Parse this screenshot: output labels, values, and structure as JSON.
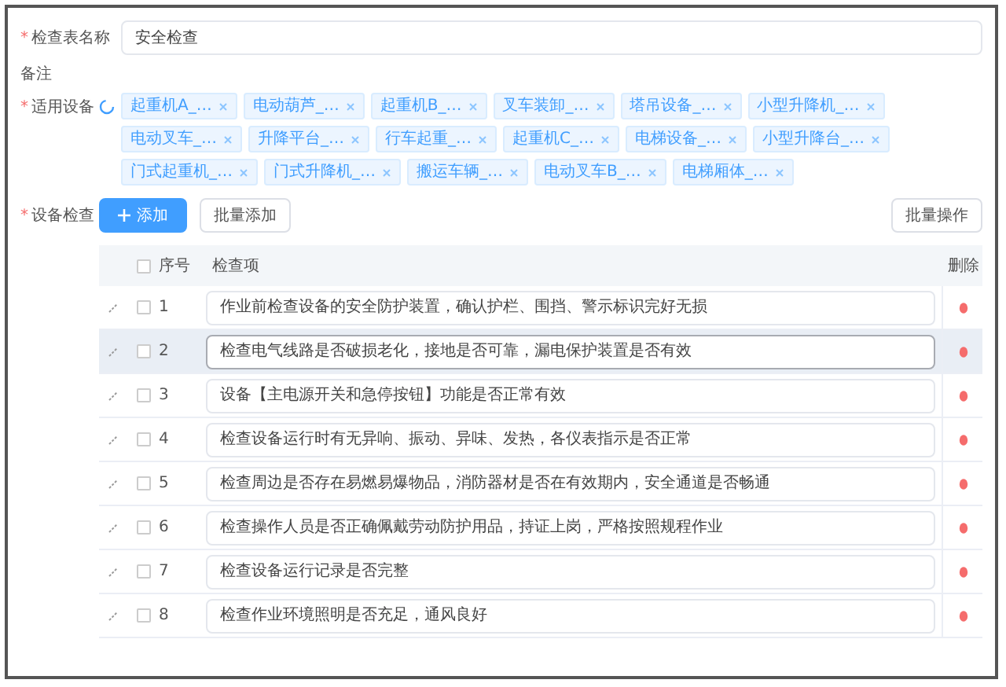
{
  "form": {
    "name_label": "检查表名称",
    "name_mark": "*",
    "name_value": "安全检查",
    "description_label": "备注",
    "devices_label": "适用设备",
    "devices_mark": "*",
    "devices": [
      "起重机A_…",
      "电动葫芦_…",
      "起重机B_…",
      "叉车装卸_…",
      "塔吊设备_…",
      "小型升降机_…",
      "电动叉车_…",
      "升降平台_…",
      "行车起重_…",
      "起重机C_…",
      "电梯设备_…",
      "小型升降台_…",
      "门式起重机_…",
      "门式升降机_…",
      "搬运车辆_…",
      "电动叉车B_…",
      "电梯厢体_…"
    ],
    "items_label": "设备检查",
    "items_mark": "*",
    "add_button": "添加",
    "batch_add_button": "批量添加",
    "batch_action_button": "批量操作"
  },
  "table": {
    "all_selected": false,
    "columns": [
      "序号",
      "检查项",
      "删除"
    ],
    "rows": [
      {
        "index": "1",
        "value": "作业前检查设备的安全防护装置，确认护栏、围挡、警示标识完好无损",
        "selected": false,
        "hovered": false
      },
      {
        "index": "2",
        "value": "检查电气线路是否破损老化，接地是否可靠，漏电保护装置是否有效",
        "selected": false,
        "hovered": true
      },
      {
        "index": "3",
        "value": "设备【主电源开关和急停按钮】功能是否正常有效",
        "selected": false,
        "hovered": false
      },
      {
        "index": "4",
        "value": "检查设备运行时有无异响、振动、异味、发热，各仪表指示是否正常",
        "selected": false,
        "hovered": false
      },
      {
        "index": "5",
        "value": "检查周边是否存在易燃易爆物品，消防器材是否在有效期内，安全通道是否畅通",
        "selected": false,
        "hovered": false
      },
      {
        "index": "6",
        "value": "检查操作人员是否正确佩戴劳动防护用品，持证上岗，严格按照规程作业",
        "selected": false,
        "hovered": false
      },
      {
        "index": "7",
        "value": "检查设备运行记录是否完整",
        "selected": false,
        "hovered": false
      },
      {
        "index": "8",
        "value": "检查作业环境照明是否充足，通风良好",
        "selected": false,
        "hovered": false
      }
    ]
  }
}
